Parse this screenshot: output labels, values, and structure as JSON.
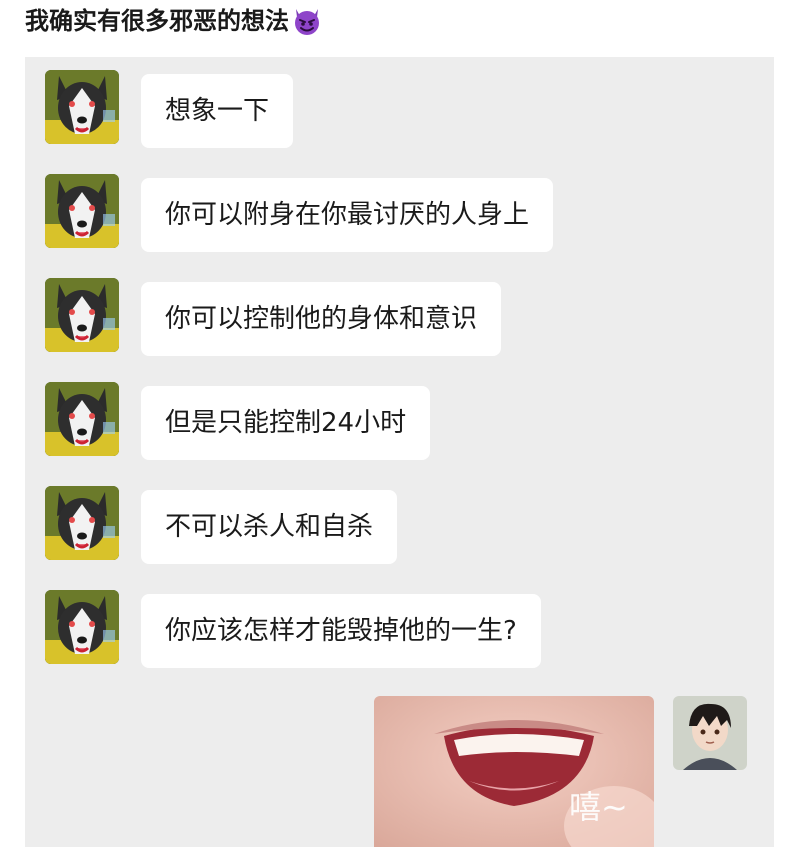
{
  "post": {
    "title": "我确实有很多邪恶的想法",
    "title_emoji": "devil-emoji"
  },
  "chat": {
    "background": "#ededed",
    "messages": [
      {
        "sender": "husky",
        "text": "想象一下"
      },
      {
        "sender": "husky",
        "text": "你可以附身在你最讨厌的人身上"
      },
      {
        "sender": "husky",
        "text": "你可以控制他的身体和意识"
      },
      {
        "sender": "husky",
        "text": "但是只能控制24小时"
      },
      {
        "sender": "husky",
        "text": "不可以杀人和自杀"
      },
      {
        "sender": "husky",
        "text": "你应该怎样才能毁掉他的一生?"
      }
    ],
    "reply": {
      "type": "sticker",
      "caption": "嘻~"
    }
  }
}
